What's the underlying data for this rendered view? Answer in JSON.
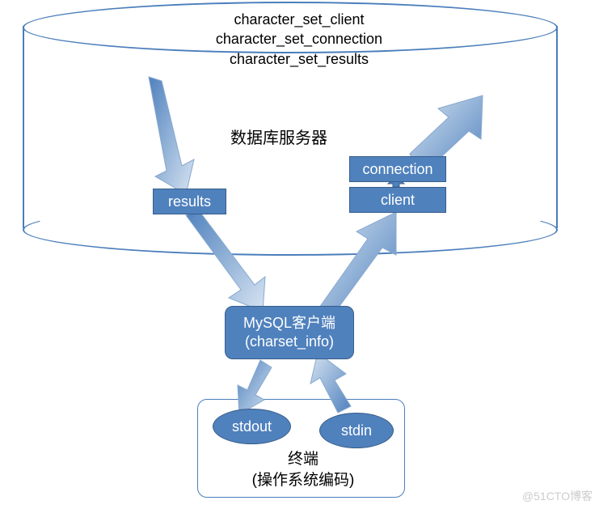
{
  "cylinder_headers": {
    "line1": "character_set_client",
    "line2": "character_set_connection",
    "line3": "character_set_results"
  },
  "server_label": "数据库服务器",
  "boxes": {
    "results": "results",
    "connection": "connection",
    "client": "client"
  },
  "mysql_client": {
    "line1": "MySQL客户端",
    "line2": "(charset_info)"
  },
  "terminal": {
    "stdout": "stdout",
    "stdin": "stdin",
    "label": "终端",
    "sublabel": "(操作系统编码)"
  },
  "watermark": "@51CTO博客",
  "colors": {
    "shape_fill": "#4f81bd",
    "shape_border": "#385d8a",
    "outline": "#4a7ebb"
  }
}
